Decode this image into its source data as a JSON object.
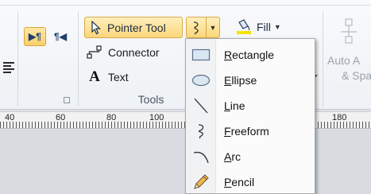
{
  "ribbon": {
    "paragraph_buttons": [
      {
        "icon": "paragraph-ltr-icon",
        "glyph": "▶¶",
        "active": true
      },
      {
        "icon": "paragraph-rtl-icon",
        "glyph": "¶◀",
        "active": false
      }
    ],
    "tools": {
      "pointer_label": "Pointer Tool",
      "connector_label": "Connector",
      "text_icon": "A",
      "text_label": "Text",
      "group_label": "Tools"
    },
    "fill_label": "Fill",
    "auto_align_line1": "Auto A",
    "auto_align_line2": "& Spa"
  },
  "ruler": {
    "numbers": [
      "40",
      "60",
      "80",
      "100",
      "180"
    ]
  },
  "shape_menu": {
    "items": [
      {
        "icon": "rectangle-icon",
        "accel": "R",
        "rest": "ectangle"
      },
      {
        "icon": "ellipse-icon",
        "accel": "E",
        "rest": "llipse"
      },
      {
        "icon": "line-icon",
        "accel": "L",
        "rest": "ine"
      },
      {
        "icon": "freeform-icon",
        "accel": "F",
        "rest": "reeform"
      },
      {
        "icon": "arc-icon",
        "accel": "A",
        "rest": "rc"
      },
      {
        "icon": "pencil-icon",
        "accel": "P",
        "rest": "encil"
      }
    ]
  },
  "colors": {
    "highlight": "#fbd77a",
    "fill_swatch": "#f5e400"
  }
}
